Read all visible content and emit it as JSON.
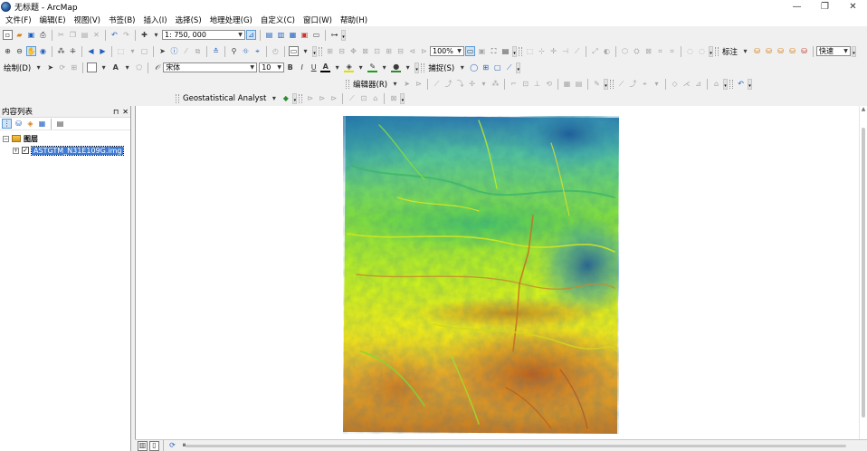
{
  "window": {
    "title": "无标题 - ArcMap",
    "controls": [
      "—",
      "❐",
      "✕"
    ]
  },
  "menu": [
    "文件(F)",
    "编辑(E)",
    "视图(V)",
    "书签(B)",
    "插入(I)",
    "选择(S)",
    "地理处理(G)",
    "自定义(C)",
    "窗口(W)",
    "帮助(H)"
  ],
  "toolbar": {
    "scale_value": "1: 750, 000",
    "zoom_value": "100%",
    "draw_label": "绘制(D)",
    "font_name": "宋体",
    "font_size": "10",
    "bold": "B",
    "italic": "I",
    "underline": "U",
    "text_tool": "A",
    "snapping_label": "捕捉(S)",
    "annotation_label": "标注",
    "speed_label": "快速",
    "editor_label": "编辑器(R)",
    "geostat_label": "Geostatistical Analyst"
  },
  "toc": {
    "title": "内容列表",
    "pin": "⊓",
    "close": "✕",
    "root_label": "图层",
    "layer_label": "ASTGTM_N31E109G.img",
    "layer_checked": "✓"
  },
  "colors": {
    "selection": "#3d7bd6",
    "dem_low": "#1b4f9c",
    "dem_mid_low": "#4fb89a",
    "dem_mid": "#7ddc2e",
    "dem_mid_high": "#f2ee1c",
    "dem_high": "#c8641e"
  }
}
